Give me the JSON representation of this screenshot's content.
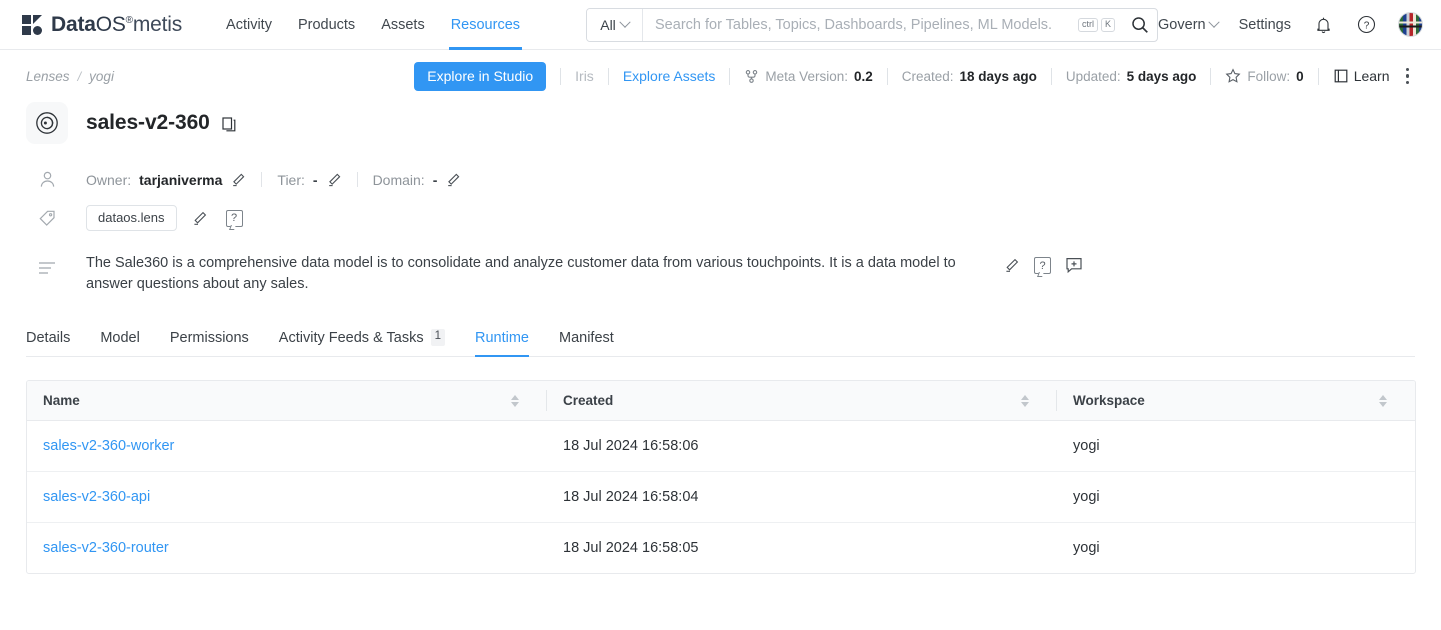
{
  "brand": {
    "name_bold": "Data",
    "name_light": "OS",
    "registered": "®",
    "product": "metis",
    "logo_icon": "dataos-logo-mark"
  },
  "nav": {
    "items": [
      {
        "label": "Activity",
        "active": false
      },
      {
        "label": "Products",
        "active": false
      },
      {
        "label": "Assets",
        "active": false
      },
      {
        "label": "Resources",
        "active": true
      }
    ]
  },
  "search": {
    "scope": "All",
    "scope_chevron_icon": "chevron-down-icon",
    "placeholder": "Search for Tables, Topics, Dashboards, Pipelines, ML Models.",
    "value": "",
    "shortcut_keys": [
      "ctrl",
      "K"
    ],
    "search_icon": "search-icon"
  },
  "nav_right": {
    "govern_label": "Govern",
    "govern_chevron_icon": "chevron-down-icon",
    "settings_label": "Settings",
    "bell_icon": "bell-icon",
    "help_icon": "help-circle-icon",
    "avatar_icon": "user-avatar"
  },
  "breadcrumb": {
    "items": [
      "Lenses",
      "yogi"
    ],
    "separator": "/"
  },
  "actionbar": {
    "explore_studio": "Explore in Studio",
    "iris": "Iris",
    "explore_assets": "Explore Assets",
    "meta_version_icon": "git-branch-icon",
    "meta_version_label": "Meta Version:",
    "meta_version_value": "0.2",
    "created_label": "Created:",
    "created_value": "18 days ago",
    "updated_label": "Updated:",
    "updated_value": "5 days ago",
    "follow_icon": "star-icon",
    "follow_label": "Follow:",
    "follow_count": "0",
    "learn_icon": "book-icon",
    "learn_label": "Learn",
    "more_icon": "kebab-menu-icon"
  },
  "entity": {
    "badge_icon": "lens-icon",
    "title": "sales-v2-360",
    "copy_icon": "copy-icon"
  },
  "owner_row": {
    "person_icon": "user-icon",
    "owner_label": "Owner:",
    "owner_value": "tarjaniverma",
    "owner_edit_icon": "pencil-icon",
    "tier_label": "Tier:",
    "tier_value": "-",
    "tier_edit_icon": "pencil-icon",
    "domain_label": "Domain:",
    "domain_value": "-",
    "domain_edit_icon": "pencil-icon"
  },
  "tag_row": {
    "tag_icon": "tag-icon",
    "tags": [
      "dataos.lens"
    ],
    "edit_icon": "pencil-icon",
    "request_tag_icon": "request-tag-icon"
  },
  "description": {
    "desc_icon": "description-lines-icon",
    "text": "The Sale360 is a comprehensive data model is to consolidate and analyze customer data from various touchpoints. It is a data model to answer questions about any sales.",
    "edit_icon": "pencil-icon",
    "request_description_icon": "request-description-icon",
    "comment_icon": "add-comment-icon"
  },
  "tabs": [
    {
      "label": "Details",
      "active": false,
      "count": null
    },
    {
      "label": "Model",
      "active": false,
      "count": null
    },
    {
      "label": "Permissions",
      "active": false,
      "count": null
    },
    {
      "label": "Activity Feeds & Tasks",
      "active": false,
      "count": "1"
    },
    {
      "label": "Runtime",
      "active": true,
      "count": null
    },
    {
      "label": "Manifest",
      "active": false,
      "count": null
    }
  ],
  "table": {
    "columns": [
      {
        "label": "Name",
        "sortable": true
      },
      {
        "label": "Created",
        "sortable": true
      },
      {
        "label": "Workspace",
        "sortable": true
      }
    ],
    "rows": [
      {
        "name": "sales-v2-360-worker",
        "created": "18 Jul 2024 16:58:06",
        "workspace": "yogi"
      },
      {
        "name": "sales-v2-360-api",
        "created": "18 Jul 2024 16:58:04",
        "workspace": "yogi"
      },
      {
        "name": "sales-v2-360-router",
        "created": "18 Jul 2024 16:58:05",
        "workspace": "yogi"
      }
    ]
  },
  "colors": {
    "accent": "#3196f3",
    "text": "#232629",
    "muted": "#9aa0a6",
    "border": "#e8eaed",
    "header_bg": "#f9fafb"
  }
}
